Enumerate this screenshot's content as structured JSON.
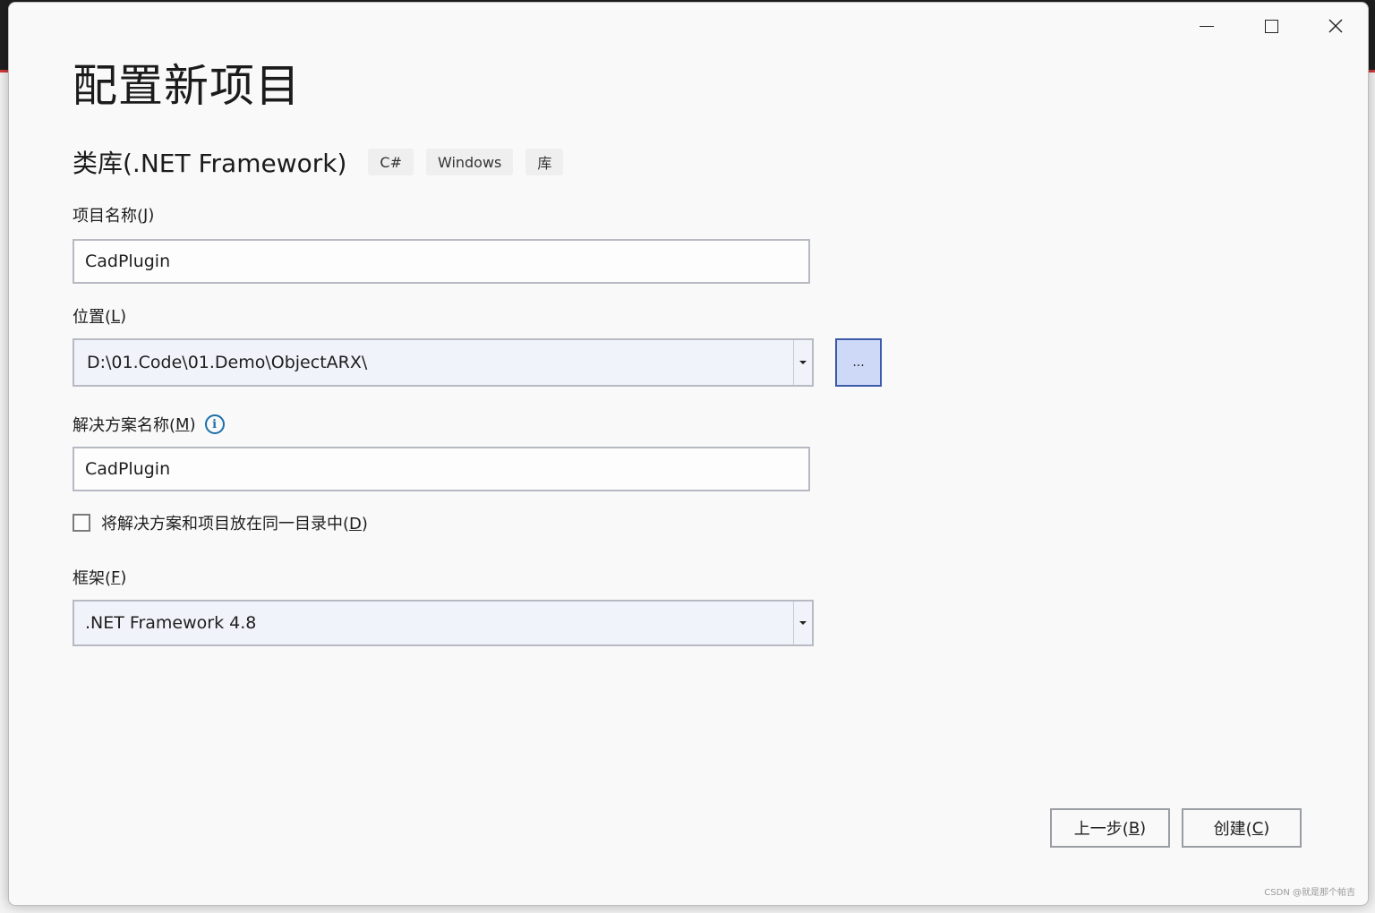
{
  "window": {
    "title": "配置新项目",
    "minimize_label": "Minimize",
    "maximize_label": "Maximize",
    "close_label": "Close"
  },
  "template": {
    "name": "类库(.NET Framework)",
    "tags": [
      "C#",
      "Windows",
      "库"
    ]
  },
  "project_name": {
    "label_text": "项目名称(",
    "label_key": "J",
    "label_end": ")",
    "value": "CadPlugin"
  },
  "location": {
    "label_text": "位置(",
    "label_key": "L",
    "label_end": ")",
    "value": "D:\\01.Code\\01.Demo\\ObjectARX\\",
    "browse_label": "..."
  },
  "solution_name": {
    "label_text": "解决方案名称(",
    "label_key": "M",
    "label_end": ")",
    "info_glyph": "i",
    "value": "CadPlugin"
  },
  "same_directory": {
    "label_text": "将解决方案和项目放在同一目录中(",
    "label_key": "D",
    "label_end": ")",
    "checked": false
  },
  "framework": {
    "label_text": "框架(",
    "label_key": "F",
    "label_end": ")",
    "value": ".NET Framework 4.8"
  },
  "buttons": {
    "back_text": "上一步(",
    "back_key": "B",
    "back_end": ")",
    "create_text": "创建(",
    "create_key": "C",
    "create_end": ")"
  },
  "watermark": "CSDN @就是那个帕吉",
  "colors": {
    "browse_button_bg": "#cdd9f7",
    "browse_button_border": "#3b5aa8",
    "info_icon": "#1a6fa8",
    "combo_bg": "#f1f3fb"
  }
}
